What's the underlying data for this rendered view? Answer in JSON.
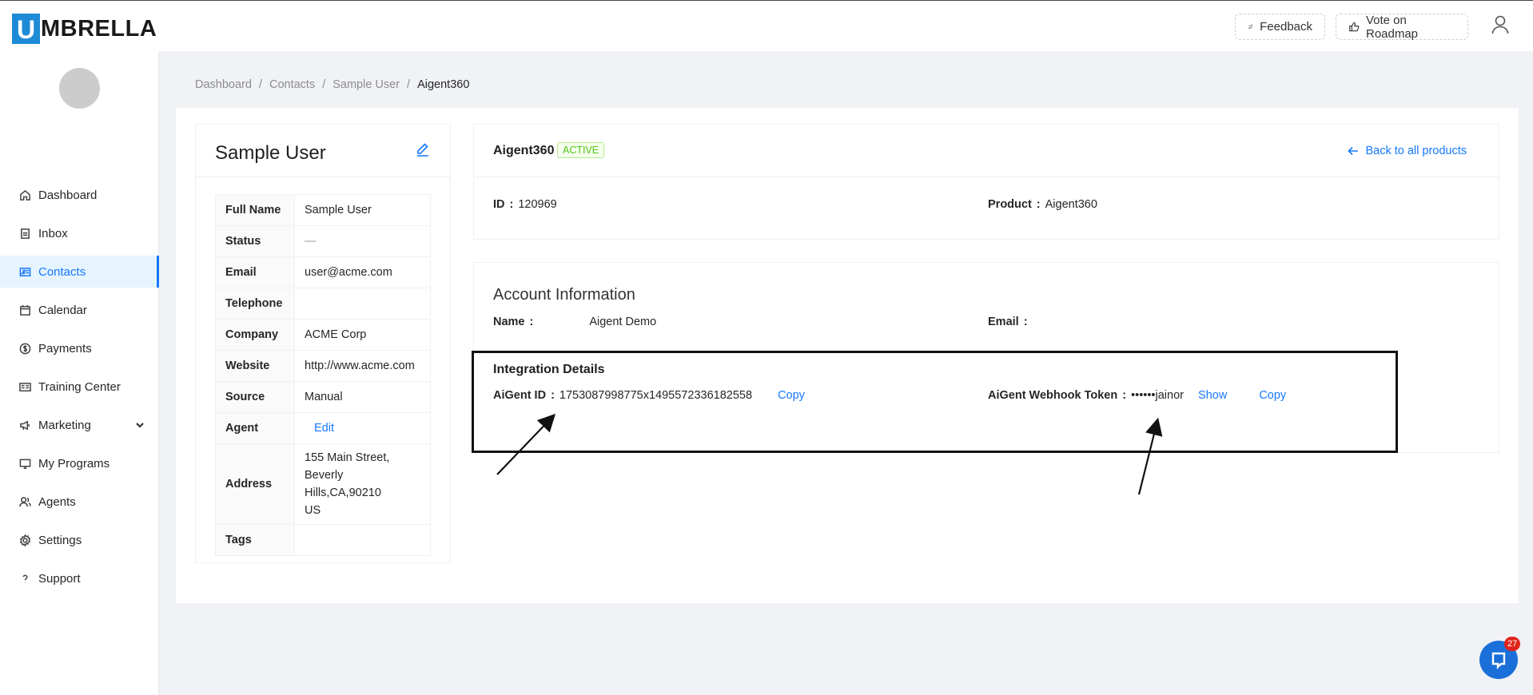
{
  "brand": {
    "logo_letter": "U",
    "logo_text": "MBRELLA",
    "accent": "#1677ff",
    "logo_color": "#1e8bd6"
  },
  "header": {
    "feedback_label": "Feedback",
    "roadmap_label": "Vote on Roadmap",
    "user_icon": "user-icon"
  },
  "sidebar": {
    "items": [
      {
        "label": "Dashboard",
        "icon": "home-icon"
      },
      {
        "label": "Inbox",
        "icon": "inbox-icon"
      },
      {
        "label": "Contacts",
        "icon": "contacts-icon",
        "active": true
      },
      {
        "label": "Calendar",
        "icon": "calendar-icon"
      },
      {
        "label": "Payments",
        "icon": "dollar-icon"
      },
      {
        "label": "Training Center",
        "icon": "training-icon"
      },
      {
        "label": "Marketing",
        "icon": "megaphone-icon",
        "has_submenu": true
      },
      {
        "label": "My Programs",
        "icon": "monitor-icon"
      },
      {
        "label": "Agents",
        "icon": "agents-icon"
      },
      {
        "label": "Settings",
        "icon": "gear-icon"
      },
      {
        "label": "Support",
        "icon": "question-icon"
      }
    ]
  },
  "breadcrumb": {
    "items": [
      "Dashboard",
      "Contacts",
      "Sample User",
      "Aigent360"
    ],
    "separator": "/"
  },
  "contact": {
    "title": "Sample User",
    "rows": [
      {
        "label": "Full Name",
        "value": "Sample User"
      },
      {
        "label": "Status",
        "value": "—"
      },
      {
        "label": "Email",
        "value": "user@acme.com"
      },
      {
        "label": "Telephone",
        "value": ""
      },
      {
        "label": "Company",
        "value": "ACME Corp"
      },
      {
        "label": "Website",
        "value": "http://www.acme.com"
      },
      {
        "label": "Source",
        "value": "Manual"
      },
      {
        "label": "Agent",
        "value": "Edit"
      },
      {
        "label": "Address",
        "value": [
          "155 Main Street,",
          "Beverly Hills,CA,90210",
          "US"
        ]
      },
      {
        "label": "Tags",
        "value": ""
      }
    ]
  },
  "product": {
    "name": "Aigent360",
    "status": "ACTIVE",
    "back_label": "Back to all products",
    "id_label": "ID",
    "id_value": "120969",
    "product_label": "Product",
    "product_value": "Aigent360"
  },
  "account": {
    "title": "Account Information",
    "name_label": "Name",
    "name_value": "Aigent Demo",
    "email_label": "Email",
    "email_value": ""
  },
  "integration": {
    "title": "Integration Details",
    "aigent_id_label": "AiGent ID",
    "aigent_id_value": "1753087998775x1495572336182558",
    "copy_label": "Copy",
    "token_label": "AiGent Webhook Token",
    "token_value": "••••••jainor",
    "show_label": "Show",
    "copy2_label": "Copy"
  },
  "chat": {
    "count": "27",
    "color": "#1a6fd8"
  }
}
